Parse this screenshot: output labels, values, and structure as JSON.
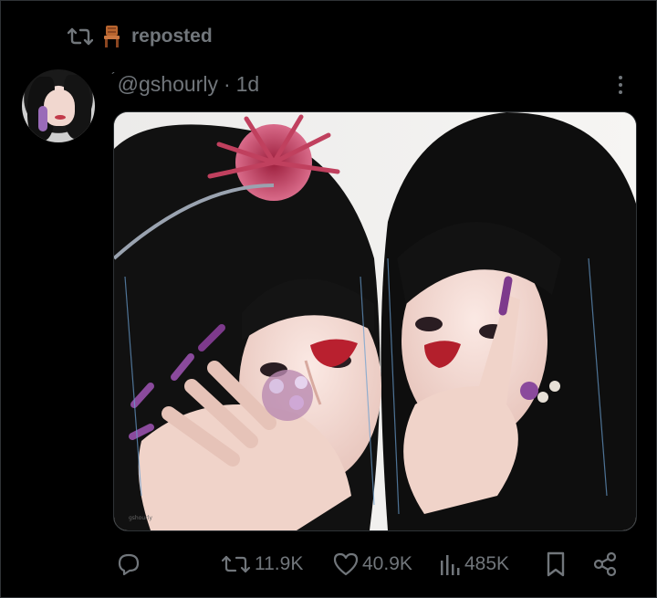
{
  "repost": {
    "label": "reposted",
    "icon": "repost-icon",
    "badge_icon": "chair-icon"
  },
  "post": {
    "handle_prefix": "´",
    "handle": "@gshourly",
    "separator": "·",
    "time": "1d",
    "media_watermark": "gshourly"
  },
  "actions": {
    "reply_count": "",
    "repost_count": "11.9K",
    "like_count": "40.9K",
    "views_count": "485K"
  },
  "colors": {
    "background": "#000000",
    "muted": "#71767b",
    "text": "#e7e9ea"
  }
}
